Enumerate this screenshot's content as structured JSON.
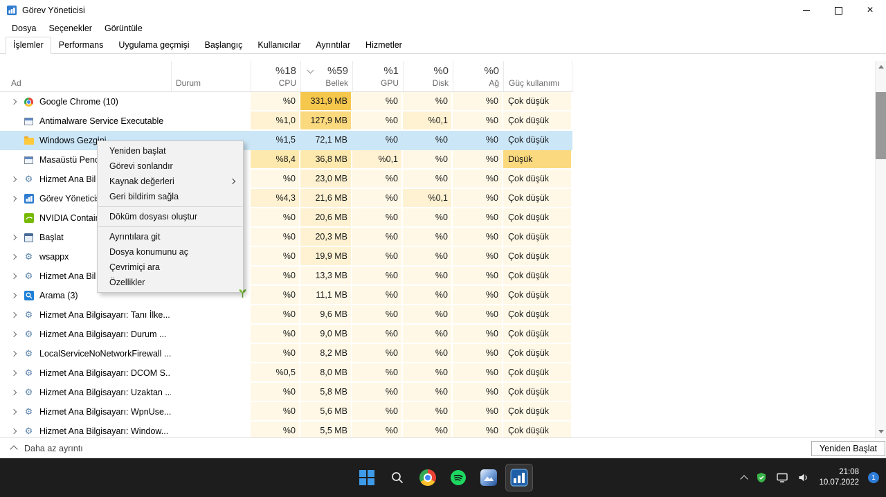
{
  "colors": {
    "heat": [
      "#FFF8E6",
      "#FEF2D2",
      "#FDE9AE",
      "#FBD97E",
      "#F6C74D"
    ],
    "selection": "#CBE6F7",
    "accent_blue": "#2F7CD0",
    "taskbar_bg": "#1D1D1D",
    "context_menu_bg": "#F2F2F2"
  },
  "titlebar": {
    "title": "Görev Yöneticisi",
    "controls": [
      "minimize",
      "maximize",
      "close"
    ]
  },
  "menubar": {
    "items": [
      {
        "label": "Dosya",
        "slug": "dosya"
      },
      {
        "label": "Seçenekler",
        "slug": "secenekler"
      },
      {
        "label": "Görüntüle",
        "slug": "goruntule"
      }
    ]
  },
  "tabs": {
    "active": "İşlemler",
    "items": [
      {
        "label": "İşlemler",
        "slug": "islemler"
      },
      {
        "label": "Performans",
        "slug": "performans"
      },
      {
        "label": "Uygulama geçmişi",
        "slug": "uygulama-gecmisi"
      },
      {
        "label": "Başlangıç",
        "slug": "baslangic"
      },
      {
        "label": "Kullanıcılar",
        "slug": "kullanicilar"
      },
      {
        "label": "Ayrıntılar",
        "slug": "ayrintilar"
      },
      {
        "label": "Hizmetler",
        "slug": "hizmetler"
      }
    ]
  },
  "table": {
    "name_header": "Ad",
    "status_header": "Durum",
    "usage_headers": [
      {
        "pct": "%18",
        "label": "CPU",
        "sorted": false
      },
      {
        "pct": "%59",
        "label": "Bellek",
        "sorted": true
      },
      {
        "pct": "%1",
        "label": "GPU",
        "sorted": false
      },
      {
        "pct": "%0",
        "label": "Disk",
        "sorted": false
      },
      {
        "pct": "%0",
        "label": "Ağ",
        "sorted": false
      },
      {
        "pct": "",
        "label": "Güç kullanımı",
        "sorted": false
      }
    ],
    "rows": [
      {
        "name": "Google Chrome (10)",
        "icon": "chrome",
        "expandable": true,
        "selected": false,
        "status": "",
        "values": [
          "%0",
          "331,9 MB",
          "%0",
          "%0",
          "%0",
          "Çok düşük"
        ],
        "heat": [
          0,
          4,
          0,
          0,
          0,
          0
        ]
      },
      {
        "name": "Antimalware Service Executable",
        "icon": "window",
        "expandable": false,
        "selected": false,
        "status": "",
        "values": [
          "%1,0",
          "127,9 MB",
          "%0",
          "%0,1",
          "%0",
          "Çok düşük"
        ],
        "heat": [
          1,
          3,
          0,
          1,
          0,
          0
        ]
      },
      {
        "name": "Windows Gezgini",
        "icon": "folder",
        "expandable": false,
        "selected": true,
        "status": "",
        "values": [
          "%1,5",
          "72,1 MB",
          "%0",
          "%0",
          "%0",
          "Çok düşük"
        ],
        "heat": [
          1,
          2,
          0,
          0,
          0,
          0
        ]
      },
      {
        "name": "Masaüstü Penc",
        "icon": "window",
        "expandable": false,
        "selected": false,
        "status": "",
        "values": [
          "%8,4",
          "36,8 MB",
          "%0,1",
          "%0",
          "%0",
          "Düşük"
        ],
        "heat": [
          2,
          2,
          1,
          0,
          0,
          3
        ]
      },
      {
        "name": "Hizmet Ana Bil",
        "icon": "gear",
        "expandable": true,
        "selected": false,
        "status": "",
        "values": [
          "%0",
          "23,0 MB",
          "%0",
          "%0",
          "%0",
          "Çok düşük"
        ],
        "heat": [
          0,
          1,
          0,
          0,
          0,
          0
        ]
      },
      {
        "name": "Görev Yöneticisi",
        "icon": "taskmgr",
        "expandable": true,
        "selected": false,
        "status": "",
        "values": [
          "%4,3",
          "21,6 MB",
          "%0",
          "%0,1",
          "%0",
          "Çok düşük"
        ],
        "heat": [
          1,
          1,
          0,
          1,
          0,
          0
        ]
      },
      {
        "name": "NVIDIA Contain",
        "icon": "nvidia",
        "expandable": false,
        "selected": false,
        "status": "",
        "values": [
          "%0",
          "20,6 MB",
          "%0",
          "%0",
          "%0",
          "Çok düşük"
        ],
        "heat": [
          0,
          1,
          0,
          0,
          0,
          0
        ]
      },
      {
        "name": "Başlat",
        "icon": "startwin",
        "expandable": true,
        "selected": false,
        "status": "",
        "values": [
          "%0",
          "20,3 MB",
          "%0",
          "%0",
          "%0",
          "Çok düşük"
        ],
        "heat": [
          0,
          1,
          0,
          0,
          0,
          0
        ]
      },
      {
        "name": "wsappx",
        "icon": "gear",
        "expandable": true,
        "selected": false,
        "status": "",
        "values": [
          "%0",
          "19,9 MB",
          "%0",
          "%0",
          "%0",
          "Çok düşük"
        ],
        "heat": [
          0,
          1,
          0,
          0,
          0,
          0
        ]
      },
      {
        "name": "Hizmet Ana Bil",
        "icon": "gear",
        "expandable": true,
        "selected": false,
        "status": "",
        "values": [
          "%0",
          "13,3 MB",
          "%0",
          "%0",
          "%0",
          "Çok düşük"
        ],
        "heat": [
          0,
          0,
          0,
          0,
          0,
          0
        ]
      },
      {
        "name": "Arama (3)",
        "icon": "search",
        "expandable": true,
        "selected": false,
        "status": "",
        "values": [
          "%0",
          "11,1 MB",
          "%0",
          "%0",
          "%0",
          "Çok düşük"
        ],
        "heat": [
          0,
          0,
          0,
          0,
          0,
          0
        ]
      },
      {
        "name": "Hizmet Ana Bilgisayarı: Tanı İlke...",
        "icon": "gear",
        "expandable": true,
        "selected": false,
        "status": "",
        "values": [
          "%0",
          "9,6 MB",
          "%0",
          "%0",
          "%0",
          "Çok düşük"
        ],
        "heat": [
          0,
          0,
          0,
          0,
          0,
          0
        ]
      },
      {
        "name": "Hizmet Ana Bilgisayarı: Durum ...",
        "icon": "gear",
        "expandable": true,
        "selected": false,
        "status": "",
        "values": [
          "%0",
          "9,0 MB",
          "%0",
          "%0",
          "%0",
          "Çok düşük"
        ],
        "heat": [
          0,
          0,
          0,
          0,
          0,
          0
        ]
      },
      {
        "name": "LocalServiceNoNetworkFirewall ...",
        "icon": "gear",
        "expandable": true,
        "selected": false,
        "status": "",
        "values": [
          "%0",
          "8,2 MB",
          "%0",
          "%0",
          "%0",
          "Çok düşük"
        ],
        "heat": [
          0,
          0,
          0,
          0,
          0,
          0
        ]
      },
      {
        "name": "Hizmet Ana Bilgisayarı: DCOM S...",
        "icon": "gear",
        "expandable": true,
        "selected": false,
        "status": "",
        "values": [
          "%0,5",
          "8,0 MB",
          "%0",
          "%0",
          "%0",
          "Çok düşük"
        ],
        "heat": [
          0,
          0,
          0,
          0,
          0,
          0
        ]
      },
      {
        "name": "Hizmet Ana Bilgisayarı: Uzaktan ...",
        "icon": "gear",
        "expandable": true,
        "selected": false,
        "status": "",
        "values": [
          "%0",
          "5,8 MB",
          "%0",
          "%0",
          "%0",
          "Çok düşük"
        ],
        "heat": [
          0,
          0,
          0,
          0,
          0,
          0
        ]
      },
      {
        "name": "Hizmet Ana Bilgisayarı: WpnUse...",
        "icon": "gear",
        "expandable": true,
        "selected": false,
        "status": "",
        "values": [
          "%0",
          "5,6 MB",
          "%0",
          "%0",
          "%0",
          "Çok düşük"
        ],
        "heat": [
          0,
          0,
          0,
          0,
          0,
          0
        ]
      },
      {
        "name": "Hizmet Ana Bilgisayarı: Window...",
        "icon": "gear",
        "expandable": true,
        "selected": false,
        "status": "",
        "values": [
          "%0",
          "5,5 MB",
          "%0",
          "%0",
          "%0",
          "Çok düşük"
        ],
        "heat": [
          0,
          0,
          0,
          0,
          0,
          0
        ]
      }
    ]
  },
  "context_menu": {
    "items": [
      {
        "label": "Yeniden başlat",
        "slug": "yeniden-baslat"
      },
      {
        "label": "Görevi sonlandır",
        "slug": "gorevi-sonlandir"
      },
      {
        "label": "Kaynak değerleri",
        "slug": "kaynak-degerleri",
        "submenu": true
      },
      {
        "label": "Geri bildirim sağla",
        "slug": "geri-bildirim-sagla"
      },
      {
        "separator": true
      },
      {
        "label": "Döküm dosyası oluştur",
        "slug": "dokum-dosyasi-olustur"
      },
      {
        "separator": true
      },
      {
        "label": "Ayrıntılara git",
        "slug": "ayrintilara-git"
      },
      {
        "label": "Dosya konumunu aç",
        "slug": "dosya-konumunu-ac"
      },
      {
        "label": "Çevrimiçi ara",
        "slug": "cevrimici-ara"
      },
      {
        "label": "Özellikler",
        "slug": "ozellikler"
      }
    ]
  },
  "statusbar": {
    "toggle_label": "Daha az ayrıntı",
    "restart_button": "Yeniden Başlat"
  },
  "taskbar": {
    "buttons": [
      {
        "name": "start",
        "active": false
      },
      {
        "name": "search",
        "active": false
      },
      {
        "name": "chrome",
        "active": false
      },
      {
        "name": "spotify",
        "active": false
      },
      {
        "name": "photos",
        "active": false
      },
      {
        "name": "taskmanager",
        "active": true
      }
    ],
    "tray_icons": [
      "hidden-icons-chevron",
      "security-shield",
      "network",
      "volume"
    ],
    "clock": {
      "time": "21:08",
      "date": "10.07.2022"
    },
    "notification_badge": "1"
  }
}
